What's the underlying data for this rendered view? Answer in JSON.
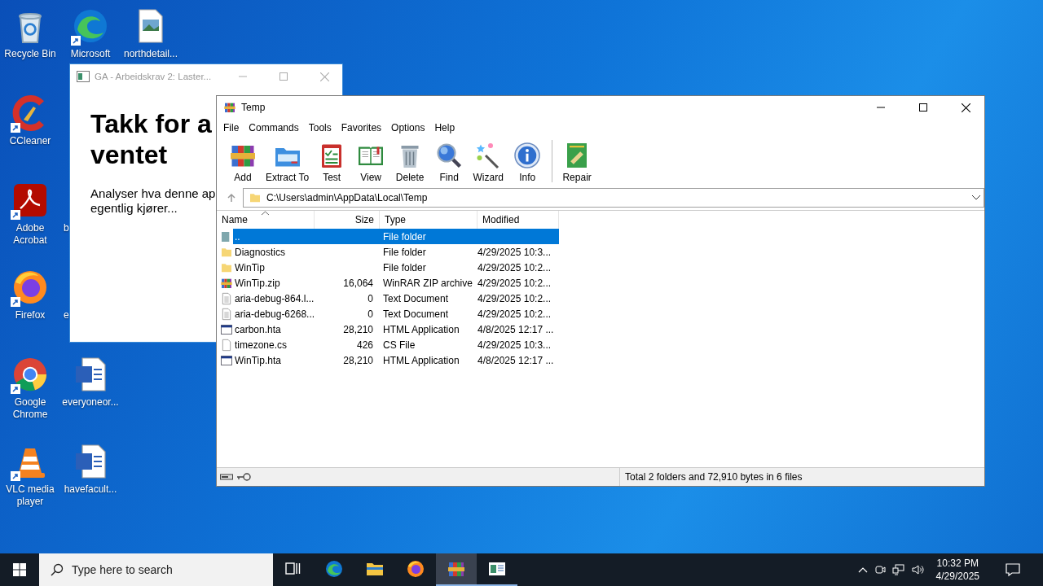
{
  "desktop": {
    "icons": [
      {
        "kind": "recycle-bin",
        "label": "Recycle Bin",
        "shortcut": false
      },
      {
        "kind": "ccleaner",
        "label": "CCleaner",
        "shortcut": true
      },
      {
        "kind": "pdf",
        "label": "Adobe Acrobat",
        "shortcut": true
      },
      {
        "kind": "firefox",
        "label": "Firefox",
        "shortcut": true
      },
      {
        "kind": "chrome",
        "label": "Google Chrome",
        "shortcut": true
      },
      {
        "kind": "vlc",
        "label": "VLC media player",
        "shortcut": true
      },
      {
        "kind": "edge",
        "label": "Microsoft",
        "shortcut": true
      },
      {
        "kind": "empty"
      },
      {
        "kind": "hidden",
        "label": "b"
      },
      {
        "kind": "hidden",
        "label": "e"
      },
      {
        "kind": "word-doc",
        "label": "everyoneor...",
        "shortcut": false
      },
      {
        "kind": "word-doc",
        "label": "havefacult...",
        "shortcut": false
      },
      {
        "kind": "image-file",
        "label": "northdetail...",
        "shortcut": false
      }
    ]
  },
  "background_window": {
    "title": "GA - Arbeidskrav 2: Laster...",
    "active": false,
    "heading_lines": [
      "Takk for a",
      "ventet"
    ],
    "paragraph_lines": [
      "Analyser hva denne ap",
      "egentlig kjører..."
    ]
  },
  "winrar": {
    "title": "Temp",
    "menu": [
      "File",
      "Commands",
      "Tools",
      "Favorites",
      "Options",
      "Help"
    ],
    "toolbar_groups": [
      [
        {
          "kind": "add",
          "label": "Add"
        },
        {
          "kind": "extract",
          "label": "Extract To"
        },
        {
          "kind": "test",
          "label": "Test"
        },
        {
          "kind": "view",
          "label": "View"
        },
        {
          "kind": "delete",
          "label": "Delete"
        },
        {
          "kind": "find",
          "label": "Find"
        },
        {
          "kind": "wizard",
          "label": "Wizard"
        },
        {
          "kind": "info",
          "label": "Info"
        }
      ],
      [
        {
          "kind": "repair",
          "label": "Repair"
        }
      ]
    ],
    "address": "C:\\Users\\admin\\AppData\\Local\\Temp",
    "columns": [
      {
        "label": "Name",
        "sorted": true
      },
      {
        "label": "Size",
        "sorted": false
      },
      {
        "label": "Type",
        "sorted": false
      },
      {
        "label": "Modified",
        "sorted": false
      }
    ],
    "rows": [
      {
        "kind": "up-folder",
        "name": "..",
        "type": "File folder",
        "selected": true
      },
      {
        "kind": "folder",
        "name": "Diagnostics",
        "type": "File folder",
        "modified": "4/29/2025 10:3...",
        "selected": false
      },
      {
        "kind": "folder",
        "name": "WinTip",
        "type": "File folder",
        "modified": "4/29/2025 10:2...",
        "selected": false
      },
      {
        "kind": "archive",
        "name": "WinTip.zip",
        "size": "16,064",
        "type": "WinRAR ZIP archive",
        "modified": "4/29/2025 10:2...",
        "selected": false
      },
      {
        "kind": "text-doc",
        "name": "aria-debug-864.l...",
        "size": "0",
        "type": "Text Document",
        "modified": "4/29/2025 10:2...",
        "selected": false
      },
      {
        "kind": "text-doc",
        "name": "aria-debug-6268...",
        "size": "0",
        "type": "Text Document",
        "modified": "4/29/2025 10:2...",
        "selected": false
      },
      {
        "kind": "hta",
        "name": "carbon.hta",
        "size": "28,210",
        "type": "HTML Application",
        "modified": "4/8/2025 12:17 ...",
        "selected": false
      },
      {
        "kind": "blank-doc",
        "name": "timezone.cs",
        "size": "426",
        "type": "CS File",
        "modified": "4/29/2025 10:3...",
        "selected": false
      },
      {
        "kind": "hta",
        "name": "WinTip.hta",
        "size": "28,210",
        "type": "HTML Application",
        "modified": "4/8/2025 12:17 ...",
        "selected": false
      }
    ],
    "status": "Total 2 folders and 72,910 bytes in 6 files"
  },
  "taskbar": {
    "search_placeholder": "Type here to search",
    "apps": [
      {
        "kind": "task-view",
        "running": false,
        "active": false
      },
      {
        "kind": "edge",
        "running": false,
        "active": false
      },
      {
        "kind": "explorer",
        "running": false,
        "active": false
      },
      {
        "kind": "firefox",
        "running": false,
        "active": false
      },
      {
        "kind": "add",
        "running": true,
        "active": true
      },
      {
        "kind": "hta-app",
        "running": true,
        "active": false
      }
    ],
    "time": "10:32 PM",
    "date": "4/29/2025"
  }
}
